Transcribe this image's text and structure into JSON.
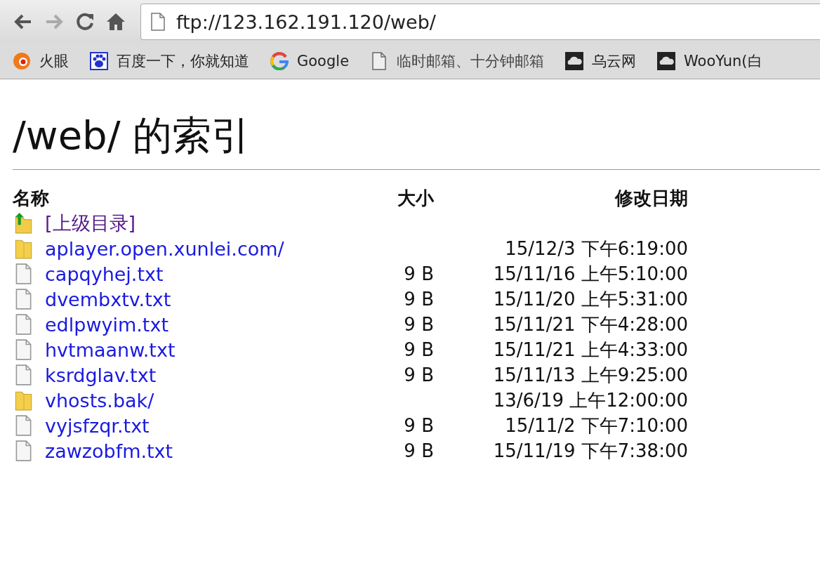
{
  "toolbar": {
    "address": "ftp://123.162.191.120/web/"
  },
  "bookmarks": [
    {
      "label": "火眼",
      "kind": "target"
    },
    {
      "label": "百度一下，你就知道",
      "kind": "paw"
    },
    {
      "label": "Google",
      "kind": "google"
    },
    {
      "label": "临时邮箱、十分钟邮箱",
      "kind": "page"
    },
    {
      "label": "乌云网",
      "kind": "cloud"
    },
    {
      "label": "WooYun(白",
      "kind": "cloud"
    }
  ],
  "heading": "/web/ 的索引",
  "table": {
    "columns": [
      "名称",
      "大小",
      "修改日期"
    ],
    "rows": [
      {
        "name": "[上级目录]",
        "kind": "parent",
        "visited": true,
        "size": "",
        "modified": ""
      },
      {
        "name": "aplayer.open.xunlei.com/",
        "kind": "folder",
        "visited": false,
        "size": "",
        "modified": "15/12/3 下午6:19:00"
      },
      {
        "name": "capqyhej.txt",
        "kind": "file",
        "visited": false,
        "size": "9 B",
        "modified": "15/11/16 上午5:10:00"
      },
      {
        "name": "dvembxtv.txt",
        "kind": "file",
        "visited": false,
        "size": "9 B",
        "modified": "15/11/20 上午5:31:00"
      },
      {
        "name": "edlpwyim.txt",
        "kind": "file",
        "visited": false,
        "size": "9 B",
        "modified": "15/11/21 下午4:28:00"
      },
      {
        "name": "hvtmaanw.txt",
        "kind": "file",
        "visited": false,
        "size": "9 B",
        "modified": "15/11/21 上午4:33:00"
      },
      {
        "name": "ksrdglav.txt",
        "kind": "file",
        "visited": false,
        "size": "9 B",
        "modified": "15/11/13 上午9:25:00"
      },
      {
        "name": "vhosts.bak/",
        "kind": "folder",
        "visited": false,
        "size": "",
        "modified": "13/6/19 上午12:00:00"
      },
      {
        "name": "vyjsfzqr.txt",
        "kind": "file",
        "visited": false,
        "size": "9 B",
        "modified": "15/11/2 下午7:10:00"
      },
      {
        "name": "zawzobfm.txt",
        "kind": "file",
        "visited": false,
        "size": "9 B",
        "modified": "15/11/19 下午7:38:00"
      }
    ]
  }
}
